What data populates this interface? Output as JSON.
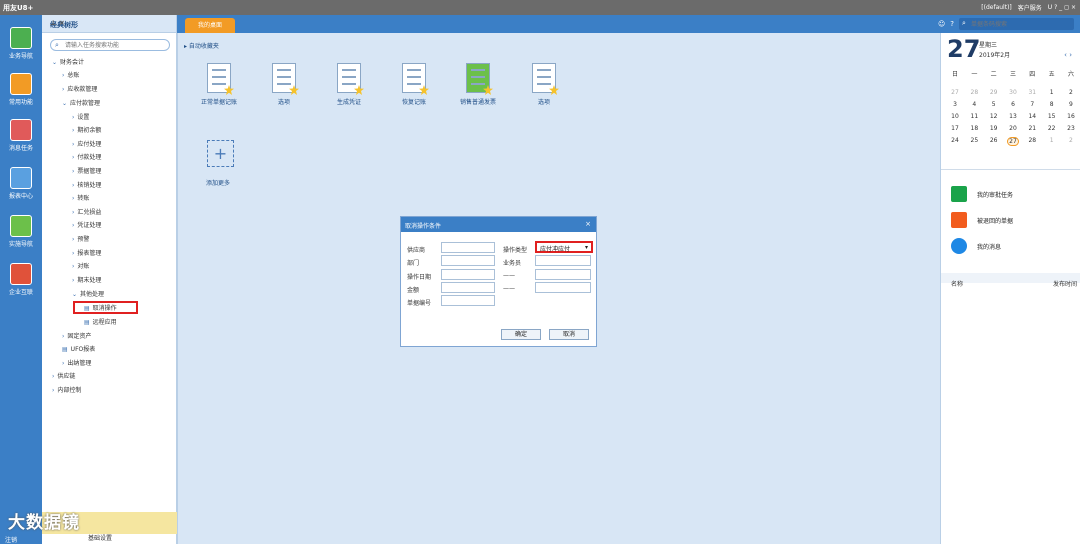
{
  "app": {
    "title": "用友U8+",
    "status": "[(default)]",
    "service": "客户服务",
    "ctl": "U ? _ ◻ ×"
  },
  "left_nav": [
    "业务导航",
    "常用功能",
    "消息任务",
    "报表中心",
    "实施导航",
    "企业互联"
  ],
  "tree_panel": {
    "title": "经典树形",
    "search_placeholder": "请输入任务搜索功能",
    "items": [
      "财务会计",
      "总账",
      "应收款管理",
      "应付款管理",
      "设置",
      "期初余额",
      "应付处理",
      "付款处理",
      "票据管理",
      "核销处理",
      "转账",
      "汇兑损益",
      "凭证处理",
      "预警",
      "报表管理",
      "对账",
      "期末处理",
      "其他处理",
      "取消操作",
      "远程应用",
      "固定资产",
      "UFO报表",
      "出纳管理",
      "供应链",
      "内部控制"
    ],
    "brand": "大数据镜",
    "base_settings": "基础设置",
    "logout": "注销"
  },
  "tabs": {
    "desktop": "我的桌面",
    "search_placeholder": "单据条码搜索"
  },
  "desktop": {
    "auto_header": "自动收藏夹",
    "tiles": [
      "正常单据记账",
      "选项",
      "生成凭证",
      "恢复记账",
      "销售普通发票",
      "选项"
    ],
    "add_more": "添加更多"
  },
  "dialog": {
    "title": "取消操作条件",
    "labels": {
      "vendor": "供应商",
      "dept": "部门",
      "op_date": "操作日期",
      "amount": "金额",
      "bill_no": "单据编号",
      "op_type": "操作类型",
      "salesman": "业务员",
      "dash1": "——",
      "dash2": "——"
    },
    "op_type_value": "应付冲应付",
    "ok": "确定",
    "cancel": "取消"
  },
  "calendar": {
    "day": "27",
    "weekday": "星期三",
    "year_month": "2019年2月",
    "headers": [
      "日",
      "一",
      "二",
      "三",
      "四",
      "五",
      "六"
    ],
    "rows": [
      [
        "27",
        "28",
        "29",
        "30",
        "31",
        "1",
        "2"
      ],
      [
        "3",
        "4",
        "5",
        "6",
        "7",
        "8",
        "9"
      ],
      [
        "10",
        "11",
        "12",
        "13",
        "14",
        "15",
        "16"
      ],
      [
        "17",
        "18",
        "19",
        "20",
        "21",
        "22",
        "23"
      ],
      [
        "24",
        "25",
        "26",
        "27",
        "28",
        "1",
        "2"
      ]
    ]
  },
  "tasks": [
    "我的审批任务",
    "被退回的单据",
    "我的消息"
  ],
  "messages": {
    "col_name": "名称",
    "col_time": "发布时间"
  },
  "colors": {
    "accent": "#3b7fc6",
    "tab_active": "#f29b25",
    "highlight": "#e02020"
  }
}
